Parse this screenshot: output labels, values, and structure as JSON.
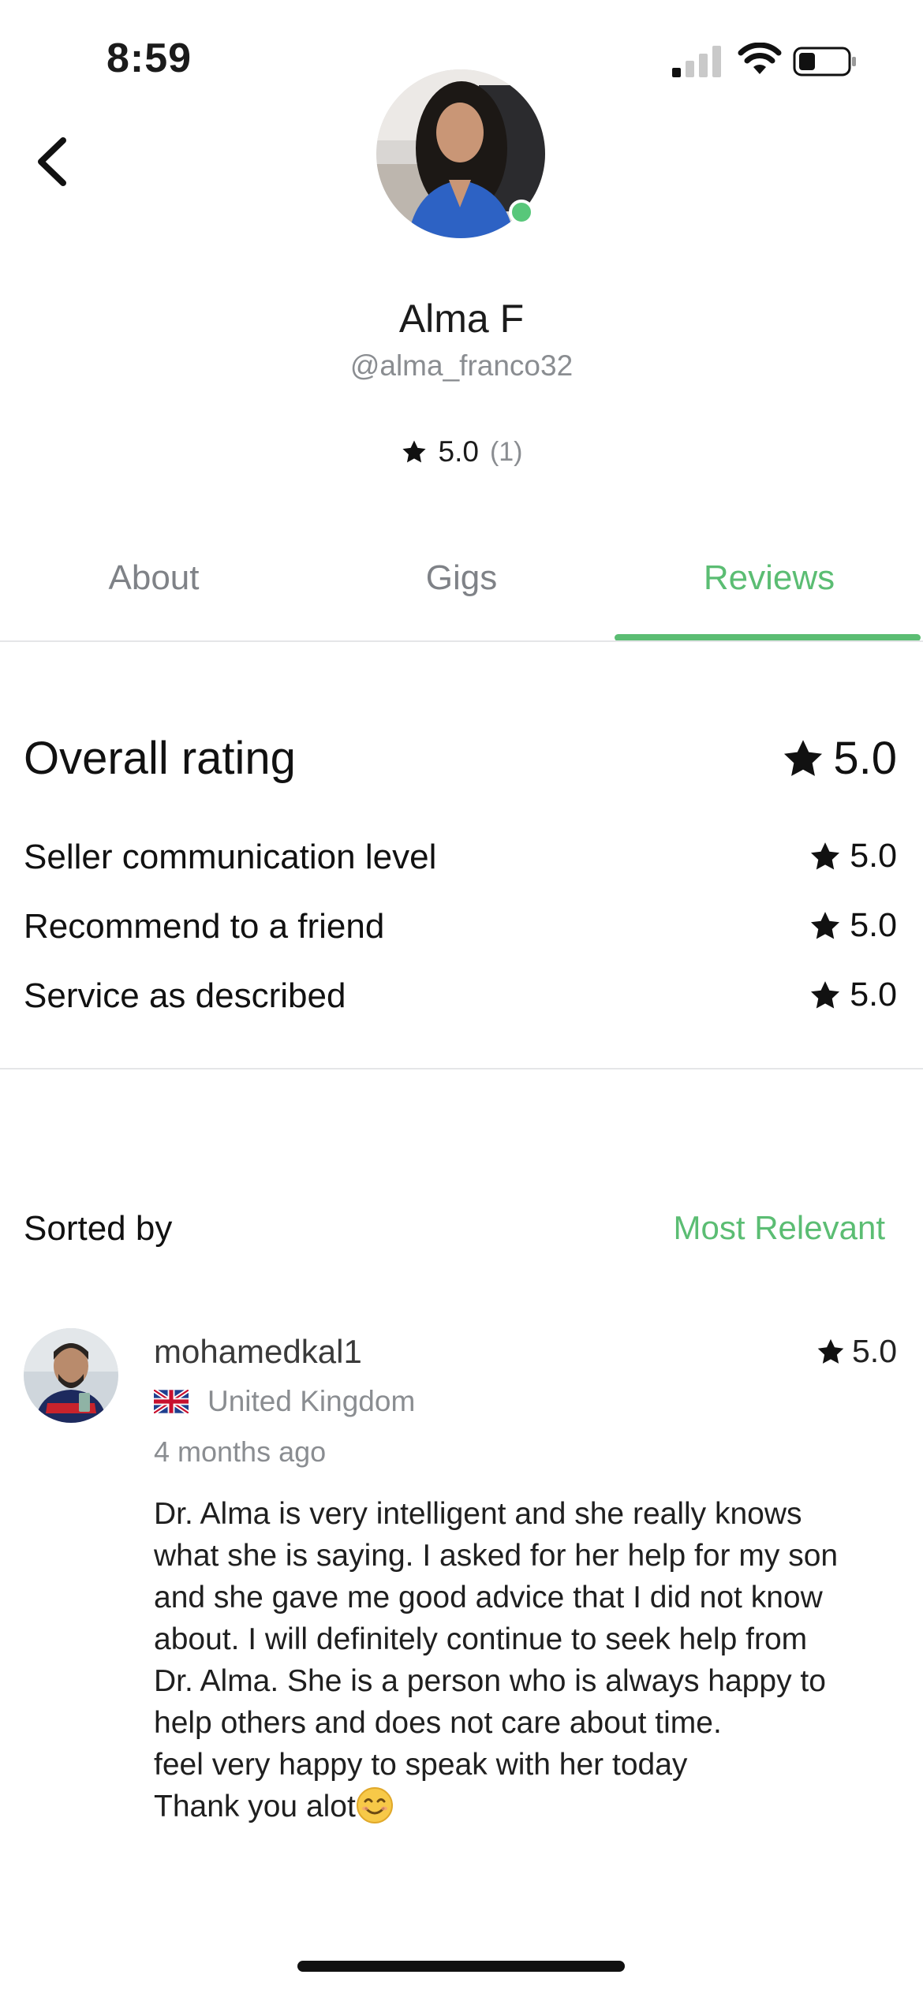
{
  "status_bar": {
    "time": "8:59"
  },
  "profile": {
    "name": "Alma F",
    "handle": "@alma_franco32",
    "rating": "5.0",
    "review_count": "(1)"
  },
  "tabs": [
    {
      "label": "About"
    },
    {
      "label": "Gigs"
    },
    {
      "label": "Reviews",
      "active": true
    }
  ],
  "ratings": {
    "overall_label": "Overall rating",
    "overall_value": "5.0",
    "items": [
      {
        "label": "Seller communication level",
        "value": "5.0"
      },
      {
        "label": "Recommend to a friend",
        "value": "5.0"
      },
      {
        "label": "Service as described",
        "value": "5.0"
      }
    ]
  },
  "sort": {
    "label": "Sorted by",
    "value": "Most Relevant"
  },
  "reviews": [
    {
      "username": "mohamedkal1",
      "rating": "5.0",
      "country": "United Kingdom",
      "time_ago": "4 months ago",
      "lines": [
        "Dr. Alma is very intelligent and she really knows",
        "what she is saying. I asked for her help for my son",
        "and she gave me good advice that I did not know",
        "about. I will definitely continue to seek help from",
        "Dr. Alma. She is a person who is always happy to",
        "help others and does not care about time.",
        "feel very happy to speak with her today",
        "Thank you alot"
      ]
    }
  ],
  "colors": {
    "accent": "#5bbd73",
    "online": "#58c77a",
    "muted": "#8a8d91"
  }
}
